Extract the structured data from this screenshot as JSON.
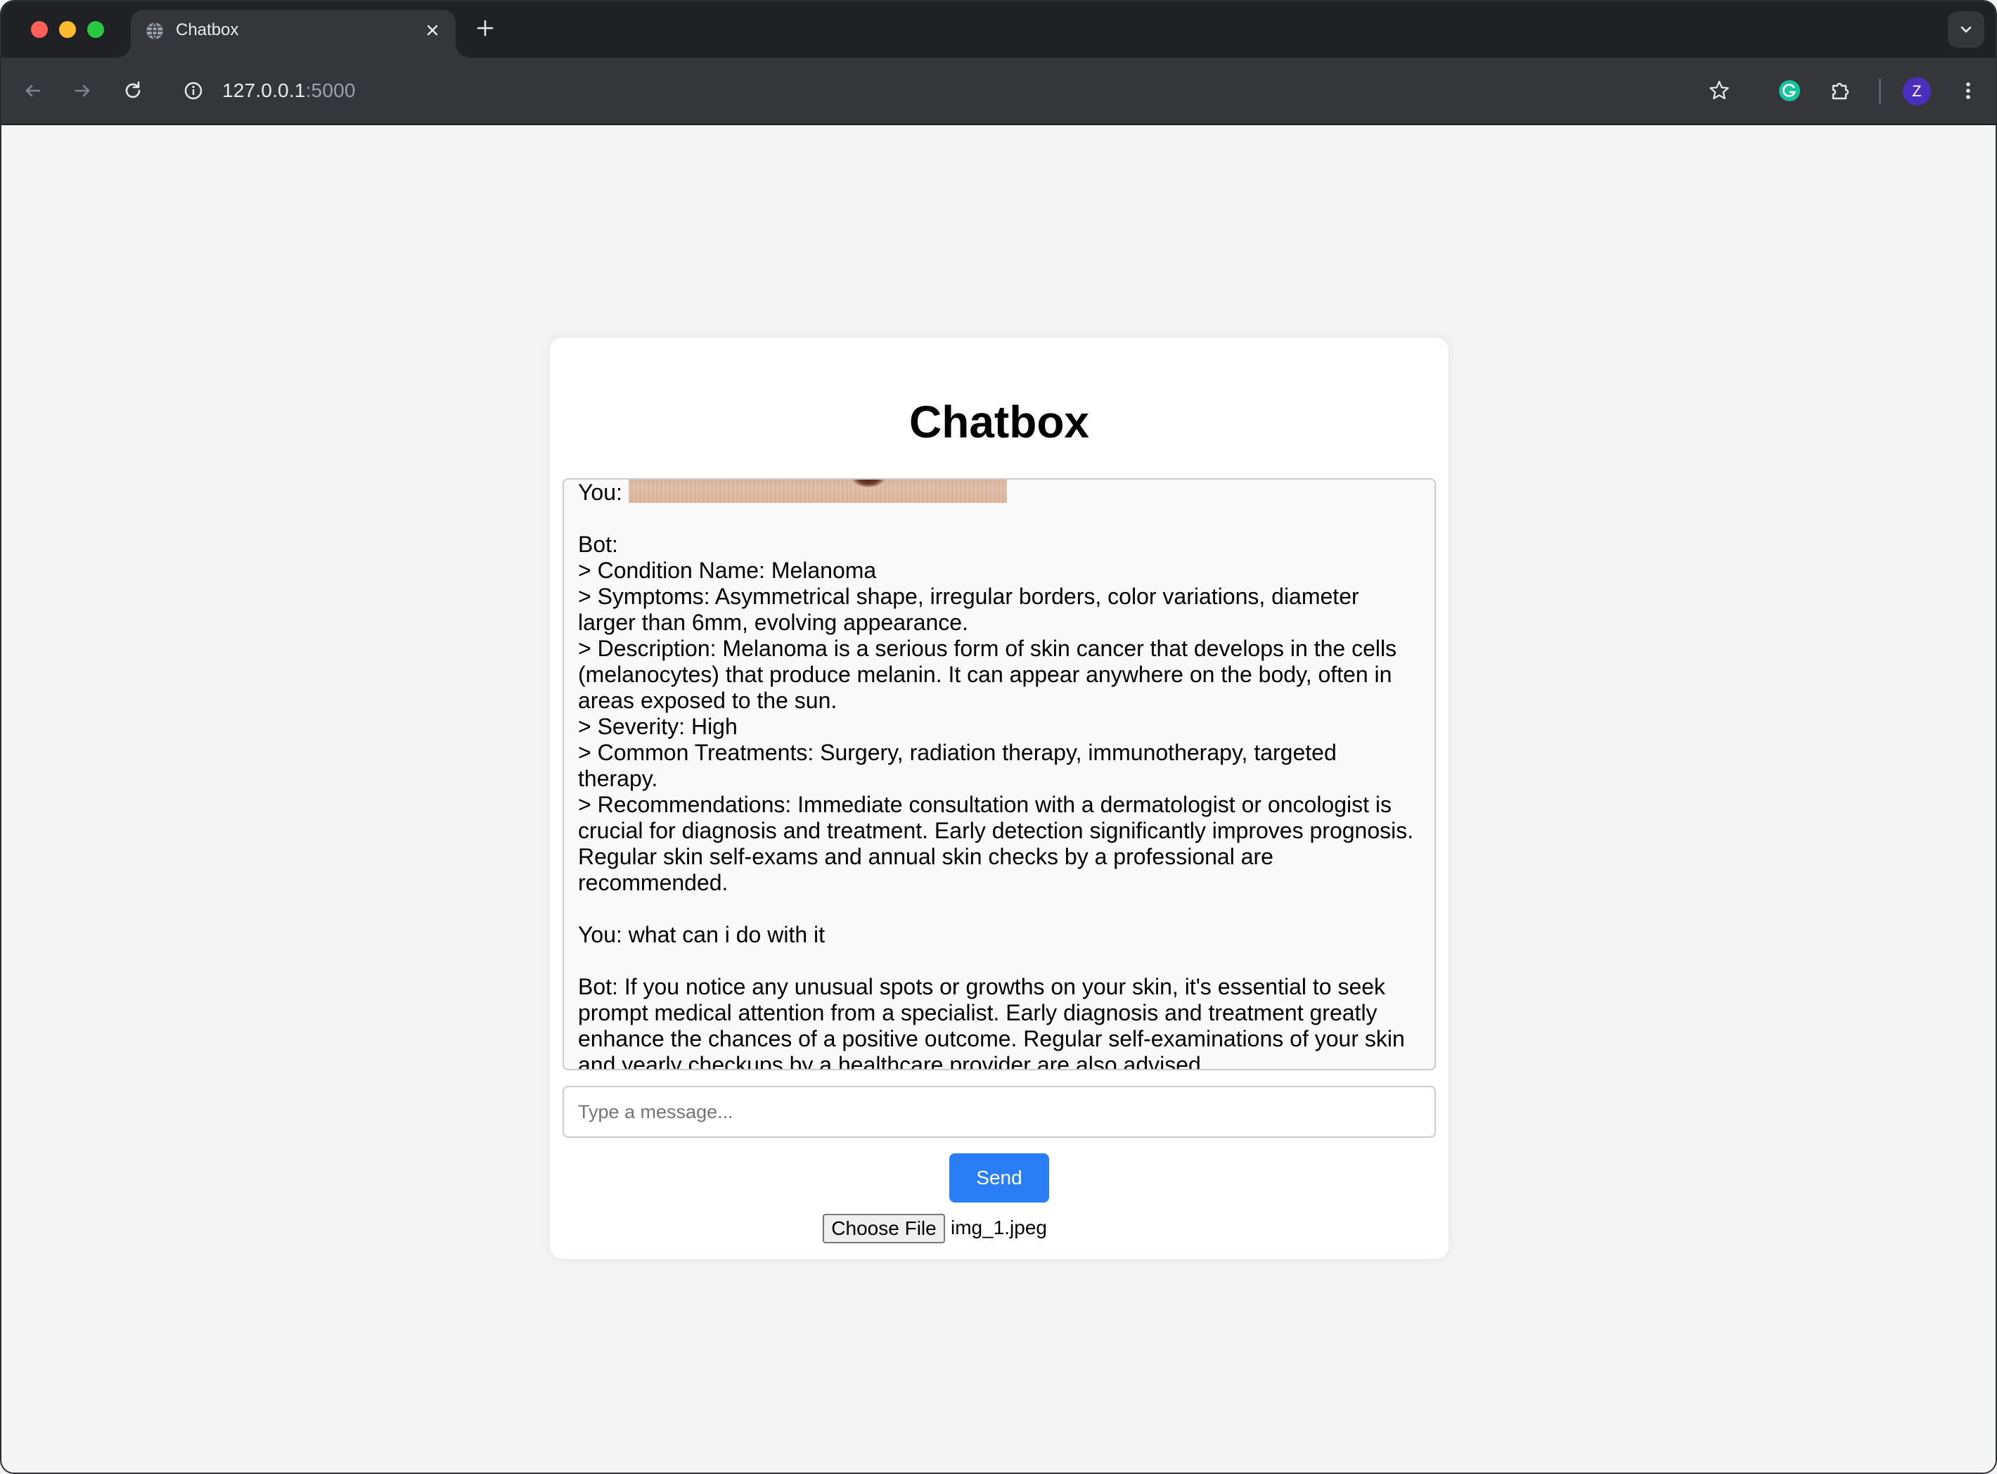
{
  "browser": {
    "tab_title": "Chatbox",
    "url_host": "127.0.0.1",
    "url_port": ":5000",
    "profile_initial": "Z"
  },
  "page": {
    "title": "Chatbox",
    "chat": {
      "image_message_sender": "You:",
      "lines": [
        "Bot:",
        "> Condition Name: Melanoma",
        "> Symptoms: Asymmetrical shape, irregular borders, color variations, diameter",
        "larger than 6mm, evolving appearance.",
        "> Description: Melanoma is a serious form of skin cancer that develops in the cells",
        "(melanocytes) that produce melanin. It can appear anywhere on the body, often in",
        "areas exposed to the sun.",
        "> Severity: High",
        "> Common Treatments: Surgery, radiation therapy, immunotherapy, targeted",
        "therapy.",
        "> Recommendations: Immediate consultation with a dermatologist or oncologist is",
        "crucial for diagnosis and treatment. Early detection significantly improves prognosis.",
        "Regular skin self-exams and annual skin checks by a professional are",
        "recommended.",
        "",
        "You: what can i do with it",
        "",
        "Bot: If you notice any unusual spots or growths on your skin, it's essential to seek",
        "prompt medical attention from a specialist. Early diagnosis and treatment greatly",
        "enhance the chances of a positive outcome. Regular self-examinations of your skin",
        "and yearly checkups by a healthcare provider are also advised."
      ]
    },
    "input": {
      "placeholder": "Type a message...",
      "value": ""
    },
    "send_label": "Send",
    "file": {
      "button_label": "Choose File",
      "selected_name": "img_1.jpeg"
    }
  }
}
